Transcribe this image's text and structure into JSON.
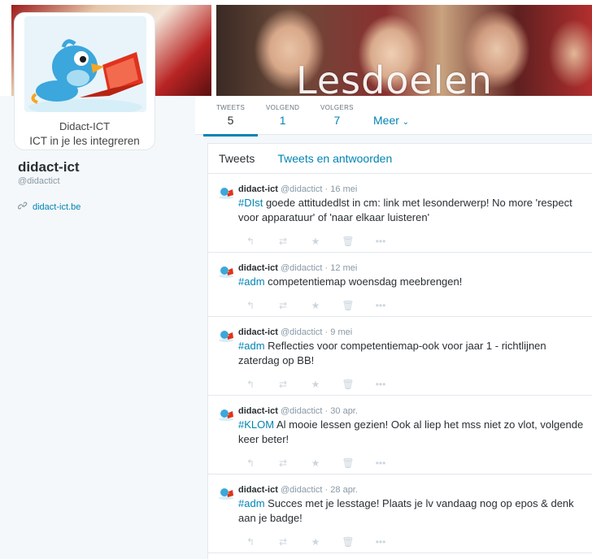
{
  "banner": {
    "title": "Lesdoelen"
  },
  "avatar_card": {
    "name": "Didact-ICT",
    "tagline": "ICT in je les integreren"
  },
  "nav": {
    "stats": [
      {
        "label": "TWEETS",
        "value": "5"
      },
      {
        "label": "VOLGEND",
        "value": "1"
      },
      {
        "label": "VOLGERS",
        "value": "7"
      }
    ],
    "more_label": "Meer",
    "more_icon": "chevron-down-icon"
  },
  "profile": {
    "name": "didact-ict",
    "handle": "@didactict",
    "link": "didact-ict.be",
    "link_icon": "link-icon"
  },
  "timeline": {
    "tabs": [
      "Tweets",
      "Tweets en antwoorden"
    ],
    "tweets": [
      {
        "name": "didact-ict",
        "handle": "@didactict",
        "date": "16 mei",
        "hashtag": "#DIst",
        "text": " goede attitudedlst in cm: link met lesonderwerp! No more 'respect voor apparatuur' of 'naar elkaar luisteren'"
      },
      {
        "name": "didact-ict",
        "handle": "@didactict",
        "date": "12 mei",
        "hashtag": "#adm",
        "text": " competentiemap woensdag meebrengen!"
      },
      {
        "name": "didact-ict",
        "handle": "@didactict",
        "date": "9 mei",
        "hashtag": "#adm",
        "text": " Reflecties voor competentiemap-ook voor jaar 1 - richtlijnen zaterdag op BB!"
      },
      {
        "name": "didact-ict",
        "handle": "@didactict",
        "date": "30 apr.",
        "hashtag": "#KLOM",
        "text": " Al mooie lessen gezien! Ook al liep het mss niet zo vlot, volgende keer beter!"
      },
      {
        "name": "didact-ict",
        "handle": "@didactict",
        "date": "28 apr.",
        "hashtag": "#adm",
        "text": " Succes met je lesstage! Plaats je lv vandaag nog op epos & denk aan je badge!"
      }
    ],
    "actions": [
      "reply-icon",
      "retweet-icon",
      "favorite-icon",
      "trash-icon",
      "more-icon"
    ]
  },
  "colors": {
    "link_blue": "#0084b4",
    "text": "#292f33",
    "muted": "#8899a6",
    "border": "#e1e8ed"
  }
}
